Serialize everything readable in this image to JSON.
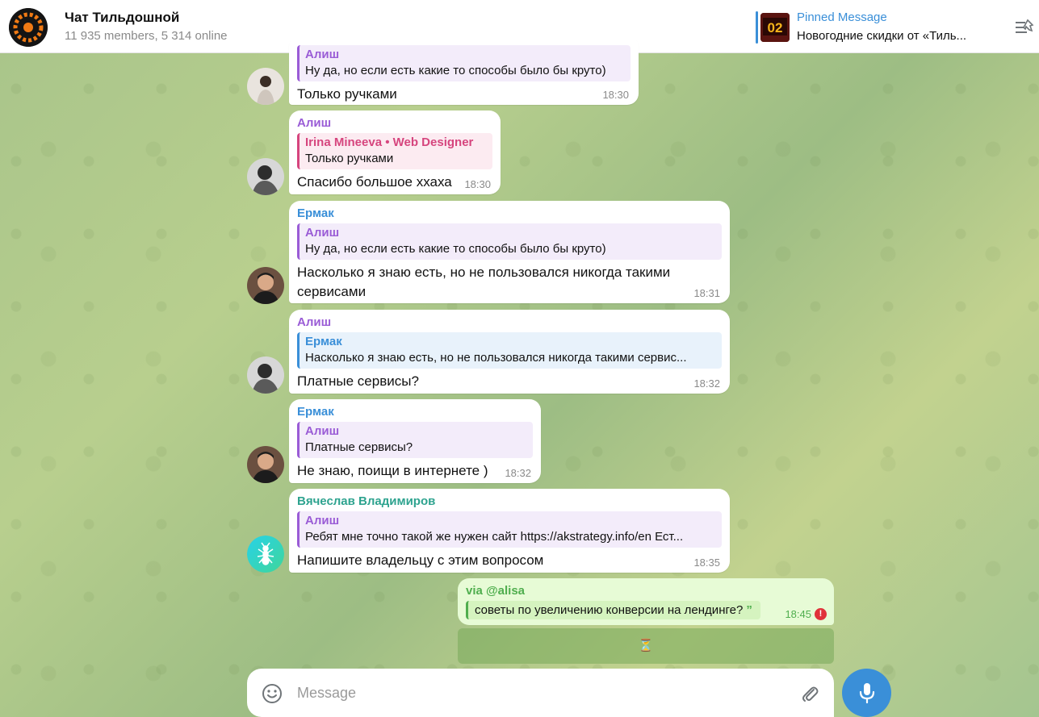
{
  "header": {
    "title": "Чат Тильдошной",
    "subtitle": "11 935 members, 5 314 online",
    "pinned_label": "Pinned Message",
    "pinned_text": "Новогодние скидки от «Тиль...",
    "pinned_thumb_text": "02"
  },
  "messages": [
    {
      "reply_name": "Алиш",
      "reply_text": "Ну да, но если есть какие то способы было бы круто)",
      "text": "Только ручками",
      "time": "18:30"
    },
    {
      "sender": "Алиш",
      "reply_name": "Irina Mineeva • Web Designer",
      "reply_text": "Только ручками",
      "text": "Спасибо большое ххаха",
      "time": "18:30"
    },
    {
      "sender": "Ермак",
      "reply_name": "Алиш",
      "reply_text": "Ну да, но если есть какие то способы было бы круто)",
      "text": "Насколько я знаю есть, но не пользовался никогда такими сервисами",
      "time": "18:31"
    },
    {
      "sender": "Алиш",
      "reply_name": "Ермак",
      "reply_text": "Насколько я знаю есть, но не пользовался никогда такими сервис...",
      "text": "Платные сервисы?",
      "time": "18:32"
    },
    {
      "sender": "Ермак",
      "reply_name": "Алиш",
      "reply_text": "Платные сервисы?",
      "text": "Не знаю, поищи в интернете )",
      "time": "18:32"
    },
    {
      "sender": "Вячеслав Владимиров",
      "reply_name": "Алиш",
      "reply_text": "Ребят мне точно такой же нужен сайт https://akstrategy.info/en Ест...",
      "text": "Напишите владельцу с этим вопросом",
      "time": "18:35"
    }
  ],
  "own_message": {
    "via": "via @alisa",
    "quote": "советы по увеличению конверсии на лендинге?",
    "quote_mark": "”",
    "time": "18:45",
    "error_mark": "!",
    "pending_icon": "⏳"
  },
  "composer": {
    "placeholder": "Message"
  },
  "colors": {
    "accent": "#3a8fd8",
    "own_bubble": "#e7fbd6",
    "error": "#e0323a"
  }
}
